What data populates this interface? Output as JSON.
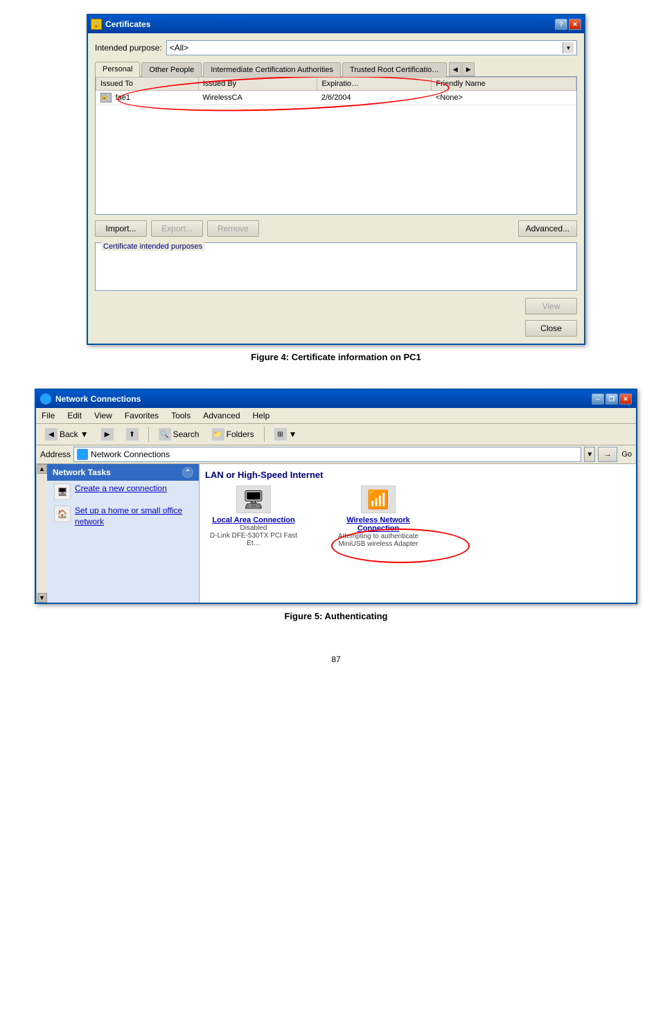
{
  "figure1": {
    "title": "Certificates",
    "intended_purpose_label": "Intended purpose:",
    "intended_purpose_value": "<All>",
    "tabs": [
      {
        "label": "Personal",
        "active": true
      },
      {
        "label": "Other People",
        "active": false
      },
      {
        "label": "Intermediate Certification Authorities",
        "active": false
      },
      {
        "label": "Trusted Root Certificatio…",
        "active": false
      }
    ],
    "table": {
      "columns": [
        "Issued To",
        "Issued By",
        "Expiratio…",
        "Friendly Name"
      ],
      "rows": [
        {
          "issued_to": "fae1",
          "issued_by": "WirelessCA",
          "expiration": "2/6/2004",
          "friendly_name": "<None>"
        }
      ]
    },
    "buttons": {
      "import": "Import...",
      "export": "Export...",
      "remove": "Remove",
      "advanced": "Advanced..."
    },
    "purposes_label": "Certificate intended purposes",
    "view_btn": "View",
    "close_btn": "Close"
  },
  "figure1_caption": "Figure 4: Certificate information on PC1",
  "figure2": {
    "title": "Network Connections",
    "menu": [
      "File",
      "Edit",
      "View",
      "Favorites",
      "Tools",
      "Advanced",
      "Help"
    ],
    "toolbar": {
      "back": "Back",
      "forward": "",
      "search": "Search",
      "folders": "Folders"
    },
    "address_label": "Address",
    "address_value": "Network Connections",
    "go_label": "Go",
    "left_panel": {
      "section_title": "Network Tasks",
      "items": [
        {
          "label": "Create a new connection"
        },
        {
          "label": "Set up a home or small office network"
        }
      ]
    },
    "right_panel": {
      "section_header": "LAN or High-Speed Internet",
      "connections": [
        {
          "name": "Local Area Connection",
          "status": "Disabled",
          "device": "D-Link DFE-530TX PCI Fast Et…"
        },
        {
          "name": "Wireless Network Connection",
          "status": "Attempting to authenticate",
          "device": "MiniUSB wireless Adapter"
        }
      ]
    }
  },
  "figure2_caption": "Figure 5: Authenticating",
  "page_number": "87"
}
